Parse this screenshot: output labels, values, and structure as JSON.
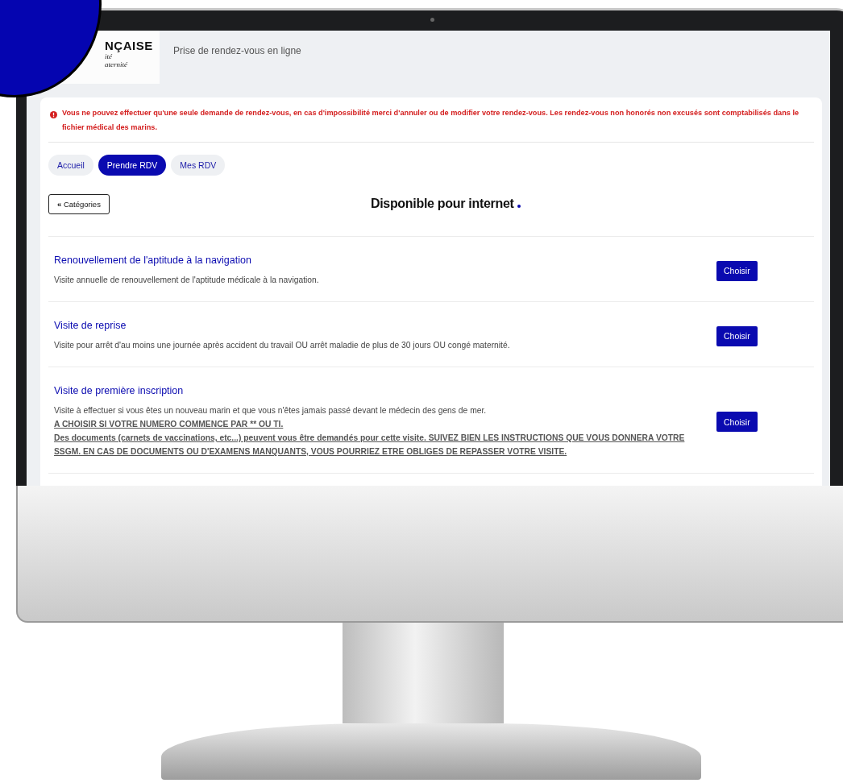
{
  "logo": {
    "lines": [
      "NÇAISE",
      "ité",
      "aternité"
    ]
  },
  "header": {
    "subtitle": "Prise de rendez-vous en ligne"
  },
  "alert": {
    "text": "Vous ne pouvez effectuer qu'une seule demande de rendez-vous, en cas d'impossibilité merci d'annuler ou de modifier votre rendez-vous. Les rendez-vous non honorés non excusés sont comptabilisés dans le fichier médical des marins."
  },
  "tabs": [
    {
      "label": "Accueil",
      "selected": false
    },
    {
      "label": "Prendre RDV",
      "selected": true
    },
    {
      "label": "Mes RDV",
      "selected": false
    }
  ],
  "back_button": {
    "icon": "«",
    "label": "Catégories"
  },
  "heading": "Disponible pour internet",
  "services": [
    {
      "title": "Renouvellement de l'aptitude à la navigation",
      "lines": [
        {
          "kind": "plain",
          "text": "Visite annuelle de renouvellement de l'aptitude médicale à la navigation."
        }
      ],
      "button": "Choisir"
    },
    {
      "title": "Visite de reprise",
      "lines": [
        {
          "kind": "plain",
          "text": "Visite pour arrêt d'au moins une journée après accident du travail OU arrêt maladie de plus de 30 jours OU congé maternité."
        }
      ],
      "button": "Choisir"
    },
    {
      "title": "Visite de première inscription",
      "lines": [
        {
          "kind": "plain",
          "text": "Visite à effectuer si vous êtes un nouveau marin et que vous n'êtes jamais passé devant le médecin des gens de mer."
        },
        {
          "kind": "notice",
          "text": "A CHOISIR SI VOTRE NUMERO COMMENCE PAR ** OU TI."
        },
        {
          "kind": "notice",
          "text": "Des documents (carnets de vaccinations, etc...) peuvent vous être demandés pour cette visite. SUIVEZ BIEN LES INSTRUCTIONS QUE VOUS DONNERA VOTRE SSGM. EN CAS DE DOCUMENTS OU D'EXAMENS MANQUANTS, VOUS POURRIEZ ETRE OBLIGES DE REPASSER VOTRE VISITE."
        }
      ],
      "button": "Choisir"
    }
  ]
}
